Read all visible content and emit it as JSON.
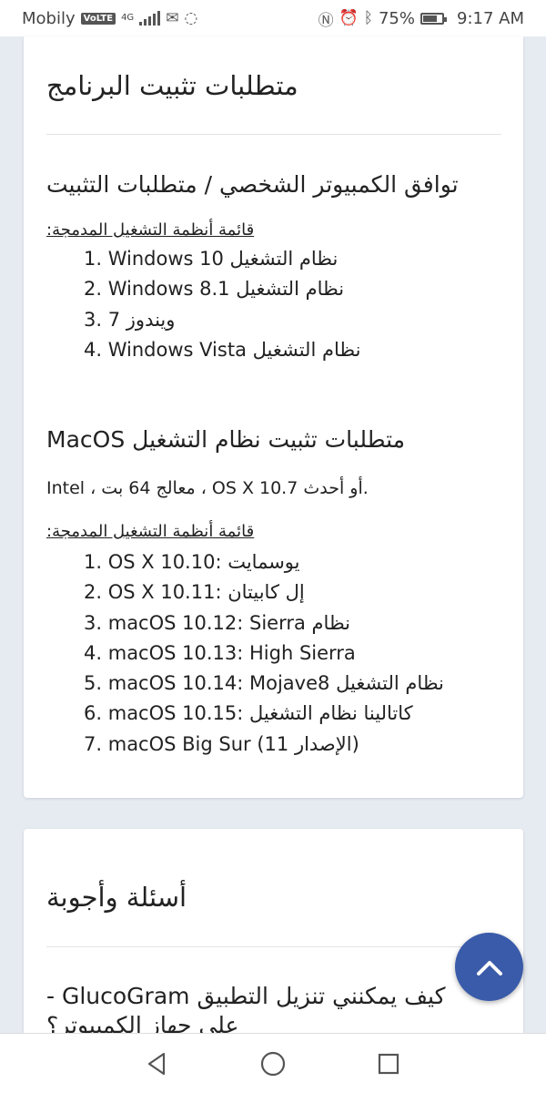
{
  "status_bar": {
    "carrier": "Mobily",
    "network_badge": "VoLTE",
    "network_type": "4G",
    "battery_percent": "75%",
    "battery_level": 0.75,
    "time": "9:17 AM",
    "icons": [
      "signal-icon",
      "message-icon",
      "whatsapp-icon",
      "nfc-icon",
      "alarm-icon",
      "bluetooth-icon",
      "battery-icon"
    ]
  },
  "requirements_card": {
    "title": "متطلبات تثبيت البرنامج",
    "windows_section": {
      "heading": "توافق الكمبيوتر الشخصي / متطلبات التثبيت",
      "subheading": "قائمة أنظمة التشغيل المدمجة:",
      "items": [
        {
          "num": "1.",
          "text": "نظام التشغيل Windows 10"
        },
        {
          "num": "2.",
          "text": "نظام التشغيل Windows 8.1"
        },
        {
          "num": "3.",
          "text": "ويندوز 7"
        },
        {
          "num": "4.",
          "text": "نظام التشغيل Windows Vista"
        }
      ]
    },
    "mac_section": {
      "heading": "MacOS متطلبات تثبيت نظام التشغيل",
      "description": "Intel ، معالج 64 بت ، OS X 10.7 أو أحدث.",
      "subheading": "قائمة أنظمة التشغيل المدمجة:",
      "items": [
        {
          "num": "1.",
          "text": "OS X 10.10: يوسمايت"
        },
        {
          "num": "2.",
          "text": "OS X 10.11: إل كابيتان"
        },
        {
          "num": "3.",
          "text": "macOS 10.12: Sierra نظام"
        },
        {
          "num": "4.",
          "text": "macOS 10.13: High Sierra"
        },
        {
          "num": "5.",
          "text": "macOS 10.14: Mojave8 نظام التشغيل"
        },
        {
          "num": "6.",
          "text": "macOS 10.15: كاتالينا نظام التشغيل"
        },
        {
          "num": "7.",
          "text": "macOS Big Sur (11 الإصدار)"
        }
      ]
    }
  },
  "faq_card": {
    "title": "أسئلة وأجوبة",
    "question": "كيف يمكنني تنزيل التطبيق GlucoGram - على جهاز الكمبيوتر؟"
  },
  "nav_bar": {
    "icons": [
      "back-icon",
      "home-icon",
      "recents-icon"
    ]
  },
  "colors": {
    "page_background": "#e6ebf2",
    "card_background": "#ffffff",
    "scroll_button": "#3a5ba9",
    "text": "#222222"
  }
}
